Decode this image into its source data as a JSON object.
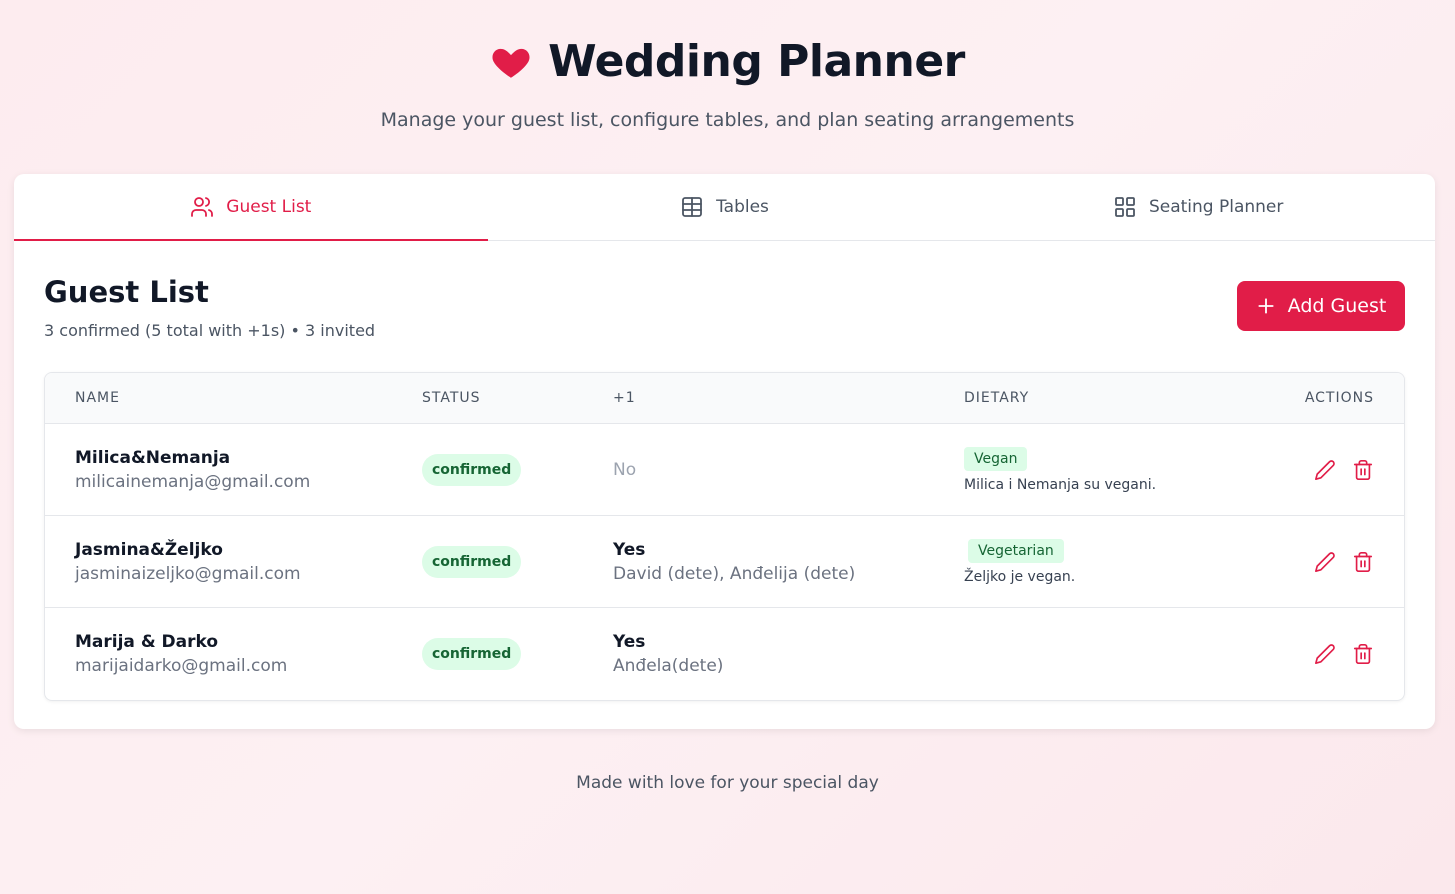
{
  "app": {
    "title": "Wedding Planner",
    "subtitle": "Manage your guest list, configure tables, and plan seating arrangements",
    "accent": "#e11d48"
  },
  "tabs": [
    {
      "label": "Guest List",
      "icon": "users-icon",
      "active": true
    },
    {
      "label": "Tables",
      "icon": "table-icon",
      "active": false
    },
    {
      "label": "Seating Planner",
      "icon": "grid-icon",
      "active": false
    }
  ],
  "guest_list": {
    "title": "Guest List",
    "summary": "3 confirmed (5 total with +1s) • 3 invited",
    "add_button": "Add Guest",
    "columns": [
      "NAME",
      "STATUS",
      "+1",
      "DIETARY",
      "ACTIONS"
    ],
    "rows": [
      {
        "name": "Milica&Nemanja",
        "email": "milicainemanja@gmail.com",
        "status": "confirmed",
        "plus_one": "No",
        "plus_detail": "",
        "dietary": "Vegan",
        "dietary_note": "Milica i Nemanja su vegani."
      },
      {
        "name": "Jasmina&Željko",
        "email": "jasminaizeljko@gmail.com",
        "status": "confirmed",
        "plus_one": "Yes",
        "plus_detail": "David (dete), Anđelija (dete)",
        "dietary": "Vegetarian",
        "dietary_note": "Željko je vegan."
      },
      {
        "name": "Marija & Darko",
        "email": "marijaidarko@gmail.com",
        "status": "confirmed",
        "plus_one": "Yes",
        "plus_detail": "Anđela(dete)",
        "dietary": "",
        "dietary_note": ""
      }
    ]
  },
  "footer": "Made with love for your special day"
}
